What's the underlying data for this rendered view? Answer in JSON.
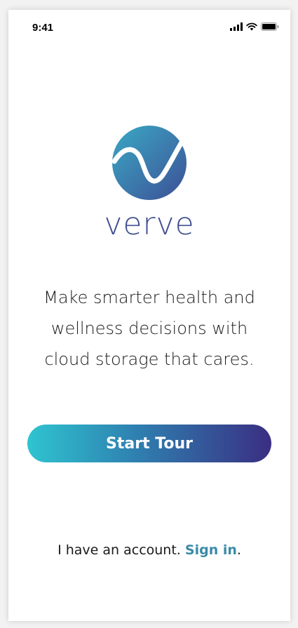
{
  "status_bar": {
    "time": "9:41",
    "icons": [
      "signal-icon",
      "wifi-icon",
      "battery-icon"
    ]
  },
  "brand": {
    "logo_icon": "verve-check-wave-icon",
    "name": "verve",
    "colors": {
      "logo_start": "#3aa9c4",
      "logo_end": "#3d4f96",
      "name": "#3f4d8f"
    }
  },
  "tagline": {
    "line1": "Make smarter health and",
    "line2": "wellness decisions with",
    "line3": "cloud storage that cares."
  },
  "start_button": {
    "label": "Start Tour",
    "gradient": [
      "#2fc4d0",
      "#2f7fb0",
      "#3a2e82"
    ]
  },
  "signin": {
    "prefix": "I have an account. ",
    "link_label": "Sign in",
    "suffix": ".",
    "link_color": "#3a8aa8"
  }
}
